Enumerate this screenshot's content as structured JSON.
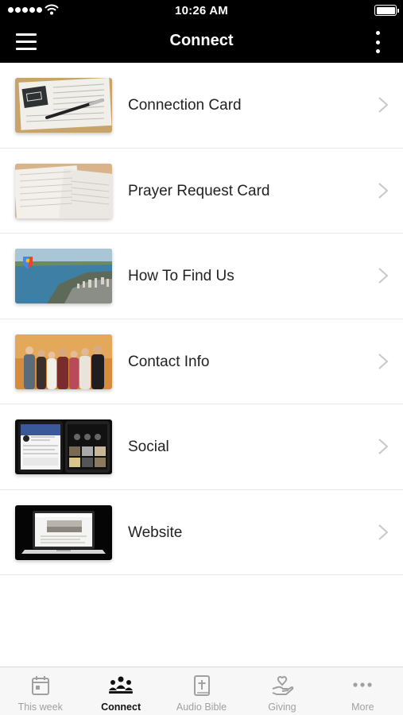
{
  "status_bar": {
    "time": "10:26 AM"
  },
  "nav": {
    "title": "Connect"
  },
  "items": [
    {
      "label": "Connection Card",
      "thumb": "connection-card-image"
    },
    {
      "label": "Prayer Request Card",
      "thumb": "prayer-request-image"
    },
    {
      "label": "How To Find Us",
      "thumb": "city-map-image"
    },
    {
      "label": "Contact Info",
      "thumb": "team-photo-image"
    },
    {
      "label": "Social",
      "thumb": "social-phones-image"
    },
    {
      "label": "Website",
      "thumb": "website-laptop-image"
    }
  ],
  "tabs": [
    {
      "label": "This week",
      "icon": "calendar-icon",
      "active": false
    },
    {
      "label": "Connect",
      "icon": "people-icon",
      "active": true
    },
    {
      "label": "Audio Bible",
      "icon": "bible-icon",
      "active": false
    },
    {
      "label": "Giving",
      "icon": "giving-hand-icon",
      "active": false
    },
    {
      "label": "More",
      "icon": "ellipsis-icon",
      "active": false
    }
  ],
  "colors": {
    "bar": "#000000",
    "tab_active": "#111111",
    "tab_inactive": "#a0a0a0"
  }
}
